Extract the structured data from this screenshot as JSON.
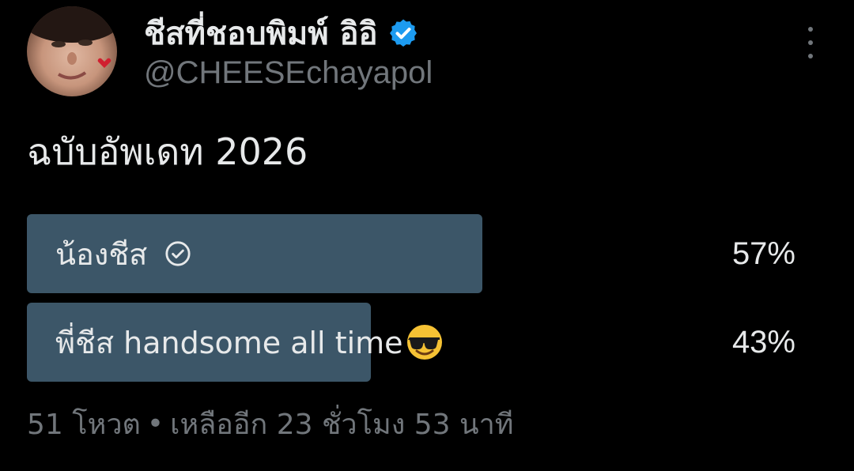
{
  "author": {
    "display_name": "ชีสที่ชอบพิมพ์ อิอิ",
    "handle": "@CHEESEchayapol",
    "verified": true,
    "verified_color": "#1d9bf0"
  },
  "tweet": {
    "text": "ฉบับอัพเดท 2026"
  },
  "poll": {
    "options": [
      {
        "label": "น้องชีส",
        "percent_text": "57%",
        "percent": 57,
        "selected": true,
        "icon": "check-circle-icon"
      },
      {
        "label": "พี่ชีส handsome all time",
        "percent_text": "43%",
        "percent": 43,
        "selected": false,
        "icon": "sunglasses-emoji-icon"
      }
    ],
    "votes": "51 โหวต",
    "separator": "•",
    "time_left": "เหลืออีก 23 ชั่วโมง 53 นาที",
    "bar_color": "#3c5668"
  },
  "colors": {
    "background": "#000000",
    "text_primary": "#e7e9ea",
    "text_secondary": "#71767b"
  },
  "icons": {
    "more": "more-vertical-icon"
  }
}
